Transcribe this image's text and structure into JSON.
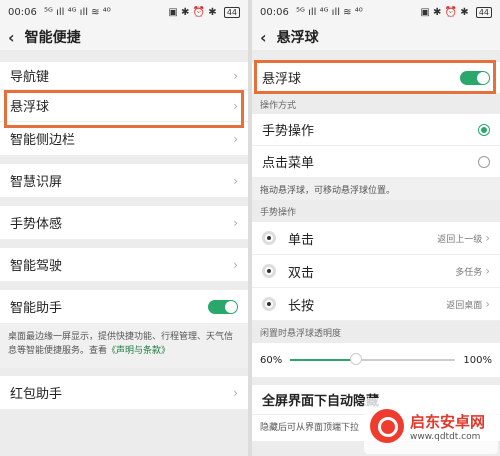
{
  "status": {
    "time": "00:06",
    "signal": "⁵ᴳ ıll ⁴ᴳ ıll ≋ ⁴⁰",
    "right_icons": "▣ ✱ ⏰ ✱",
    "battery": "44"
  },
  "left": {
    "title": "智能便捷",
    "items": [
      {
        "label": "导航键"
      },
      {
        "label": "悬浮球"
      },
      {
        "label": "智能侧边栏"
      },
      {
        "label": "智慧识屏"
      },
      {
        "label": "手势体感"
      },
      {
        "label": "智能驾驶"
      },
      {
        "label": "智能助手"
      },
      {
        "label": "红包助手"
      }
    ],
    "assistant_desc_part1": "桌面最边缘一屏显示，提供快捷功能、行程管理、天气信息等智能便捷服务。查看",
    "assistant_desc_link": "《声明与条款》"
  },
  "right": {
    "title": "悬浮球",
    "float_ball_label": "悬浮球",
    "operation_mode_label": "操作方式",
    "gesture_mode": "手势操作",
    "click_menu": "点击菜单",
    "drag_hint": "拖动悬浮球，可移动悬浮球位置。",
    "gesture_section_label": "手势操作",
    "gestures": [
      {
        "label": "单击",
        "value": "返回上一级"
      },
      {
        "label": "双击",
        "value": "多任务"
      },
      {
        "label": "长按",
        "value": "返回桌面"
      }
    ],
    "opacity_label": "闲置时悬浮球透明度",
    "opacity_min": "60%",
    "opacity_max": "100%",
    "opacity_level": 0.4,
    "fullscreen_label": "全屏界面下自动隐藏",
    "fullscreen_desc": "隐藏后可从界面顶端下拉"
  },
  "watermark": {
    "name": "启东安卓网",
    "url": "www.qdtdt.com"
  },
  "colors": {
    "accent": "#2aa76b",
    "highlight": "#e6703a"
  }
}
